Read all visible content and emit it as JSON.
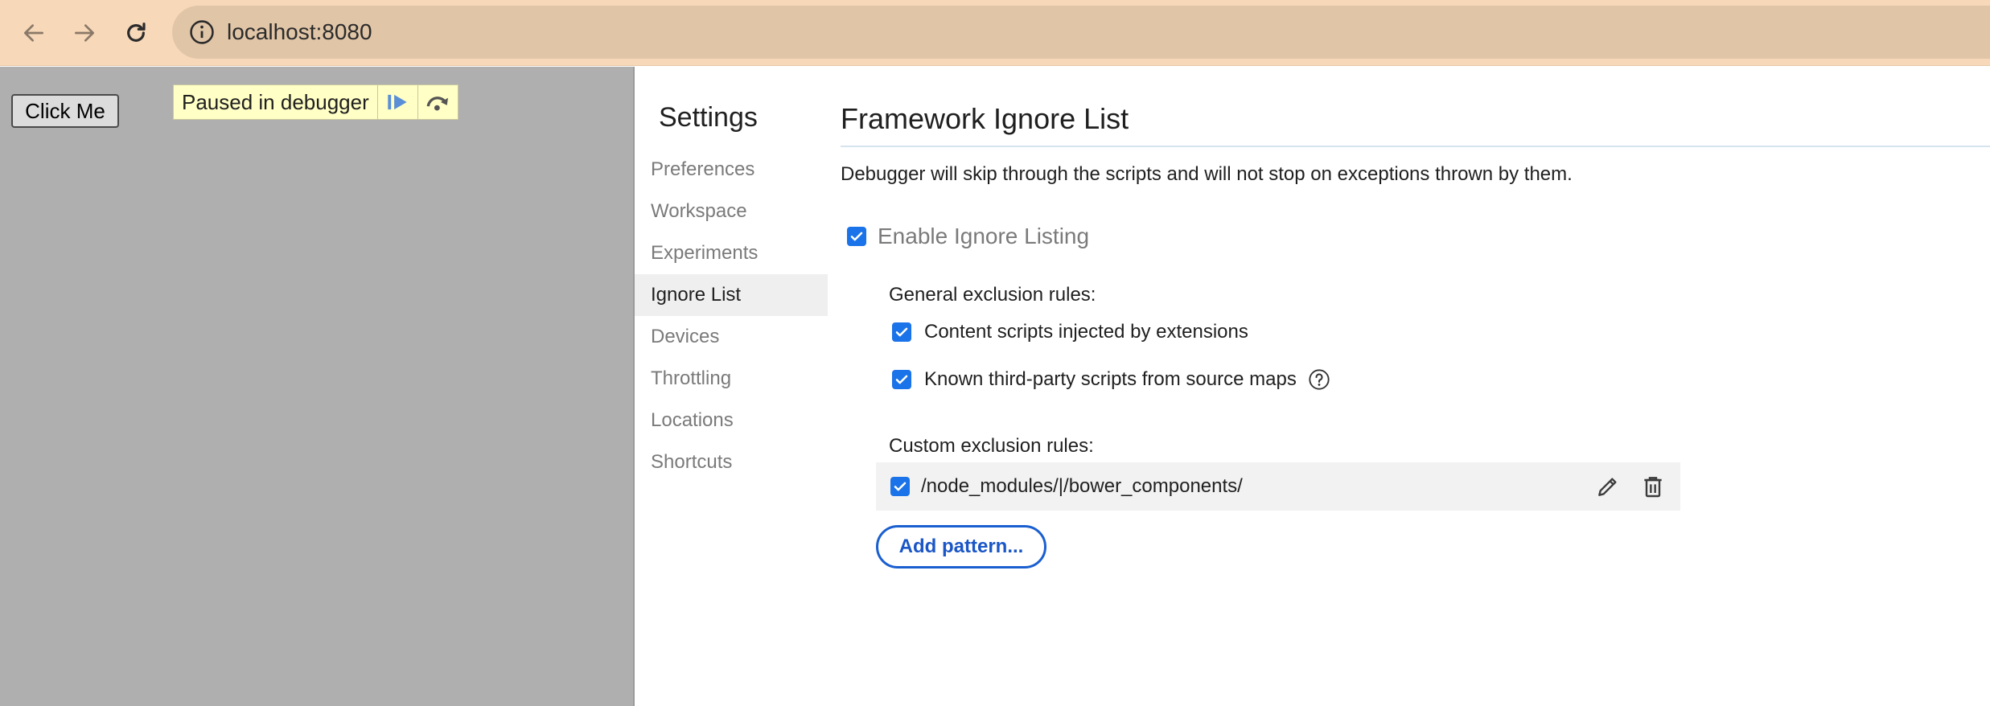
{
  "browser": {
    "url": "localhost:8080"
  },
  "page": {
    "click_button_label": "Click Me",
    "paused_label": "Paused in debugger"
  },
  "settings": {
    "title": "Settings",
    "nav": [
      {
        "label": "Preferences"
      },
      {
        "label": "Workspace"
      },
      {
        "label": "Experiments"
      },
      {
        "label": "Ignore List"
      },
      {
        "label": "Devices"
      },
      {
        "label": "Throttling"
      },
      {
        "label": "Locations"
      },
      {
        "label": "Shortcuts"
      }
    ],
    "active_nav": "Ignore List"
  },
  "ignore_list": {
    "title": "Framework Ignore List",
    "description": "Debugger will skip through the scripts and will not stop on exceptions thrown by them.",
    "enable_label": "Enable Ignore Listing",
    "general_label": "General exclusion rules:",
    "general_rules": [
      {
        "label": "Content scripts injected by extensions",
        "checked": true
      },
      {
        "label": "Known third-party scripts from source maps",
        "checked": true
      }
    ],
    "custom_label": "Custom exclusion rules:",
    "custom_rules": [
      {
        "pattern": "/node_modules/|/bower_components/",
        "checked": true
      }
    ],
    "add_pattern_label": "Add pattern..."
  },
  "colors": {
    "toolbar": "#f7d8b9",
    "omnibox": "#e1c5a7",
    "checkbox": "#1a73e8",
    "accent": "#1a56c6"
  }
}
